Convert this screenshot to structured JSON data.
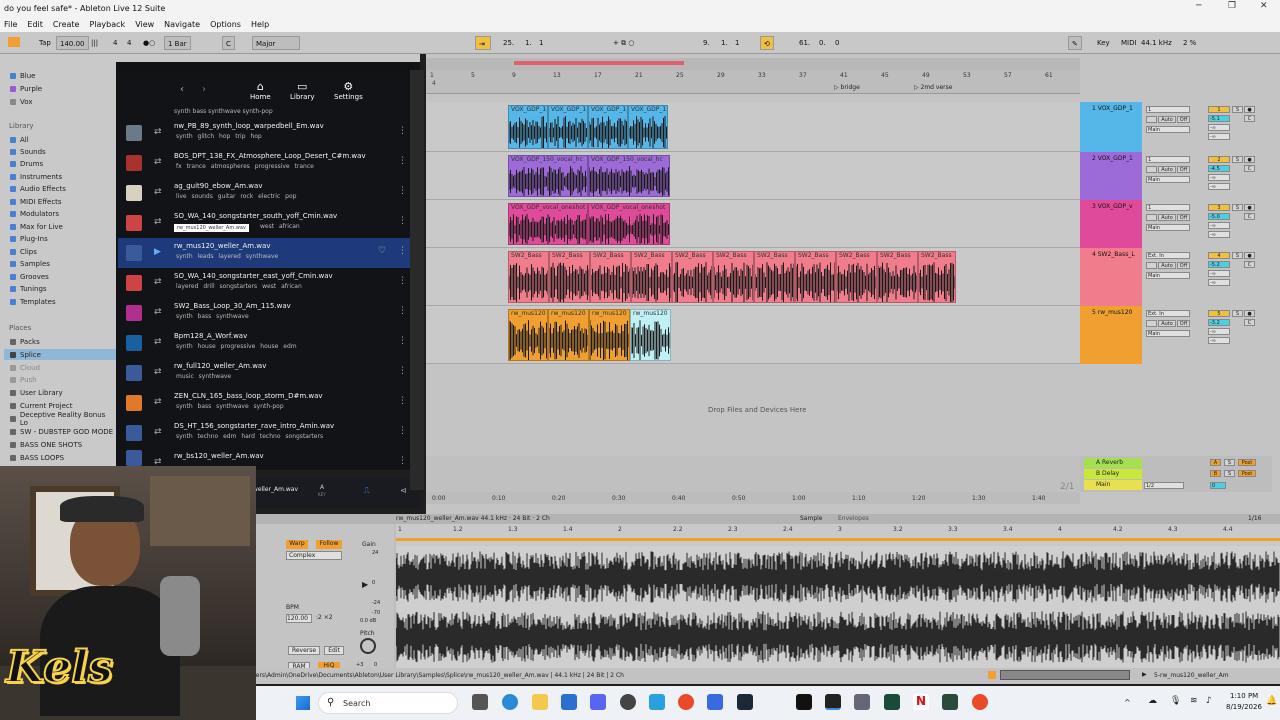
{
  "window": {
    "title": "do you feel safe* - Ableton Live 12 Suite"
  },
  "menu": [
    "File",
    "Edit",
    "Create",
    "Playback",
    "View",
    "Navigate",
    "Options",
    "Help"
  ],
  "control_bar": {
    "tap": "Tap",
    "tempo": "140.00",
    "time_sig_num": "4",
    "time_sig_den": "4",
    "quantize": "1 Bar",
    "key": "C",
    "scale": "Major",
    "position": [
      "25.",
      "1.",
      "1"
    ],
    "loop_start": [
      "9.",
      "1.",
      "1"
    ],
    "loop_length": [
      "61.",
      "0.",
      "0"
    ],
    "key_label": "Key",
    "midi_label": "MIDI",
    "sample_rate": "44.1 kHz",
    "cpu": "2 %"
  },
  "browser": {
    "colors": [
      {
        "label": "Blue",
        "color": "#4a7fd6"
      },
      {
        "label": "Purple",
        "color": "#9b59d6"
      },
      {
        "label": "Vox",
        "color": "#888888"
      }
    ],
    "library_heading": "Library",
    "library": [
      "All",
      "Sounds",
      "Drums",
      "Instruments",
      "Audio Effects",
      "MIDI Effects",
      "Modulators",
      "Max for Live",
      "Plug-Ins",
      "Clips",
      "Samples",
      "Grooves",
      "Tunings",
      "Templates"
    ],
    "places_heading": "Places",
    "places": [
      "Packs",
      "Splice",
      "Cloud",
      "Push",
      "User Library",
      "Current Project",
      "Deceptive Reality Bonus Lo",
      "SW - DUBSTEP GOD MODE",
      "BASS ONE SHOTS",
      "BASS LOOPS"
    ]
  },
  "splice": {
    "nav": {
      "home": "Home",
      "library": "Library",
      "settings": "Settings"
    },
    "top_tags": "synth  bass  synthwave  synth-pop",
    "rows": [
      {
        "name": "nw_PB_89_synth_loop_warpedbell_Em.wav",
        "tags": "synth  glitch hop  trip hop",
        "color": "#6a7a8a"
      },
      {
        "name": "BOS_DPT_138_FX_Atmosphere_Loop_Desert_C#m.wav",
        "tags": "fx  trance  atmospheres  progressive trance",
        "color": "#a8322e"
      },
      {
        "name": "ag_guit90_ebow_Am.wav",
        "tags": "live sounds  guitar  rock  electric  pop",
        "color": "#d9d0c0"
      },
      {
        "name": "SO_WA_140_songstarter_south_yoff_Cmin.wav",
        "tags": "west african",
        "tooltip": "rw_mus120_weller_Am.wav",
        "color": "#c44"
      },
      {
        "name": "rw_mus120_weller_Am.wav",
        "tags": "synth  leads  layered  synthwave",
        "color": "#3b5a9c",
        "active": true
      },
      {
        "name": "SO_WA_140_songstarter_east_yoff_Cmin.wav",
        "tags": "layered  drill  songstarters  west african",
        "color": "#c44"
      },
      {
        "name": "SW2_Bass_Loop_30_Am_115.wav",
        "tags": "synth  bass  synthwave",
        "color": "#b03090"
      },
      {
        "name": "Bpm128_A_Worf.wav",
        "tags": "synth  house  progressive house  edm",
        "color": "#1a5fa0"
      },
      {
        "name": "rw_full120_weller_Am.wav",
        "tags": "music  synthwave",
        "color": "#3b5a9c"
      },
      {
        "name": "ZEN_CLN_165_bass_loop_storm_D#m.wav",
        "tags": "synth  bass  synthwave  synth-pop",
        "color": "#e07a2a"
      },
      {
        "name": "DS_HT_156_songstarter_rave_intro_Amin.wav",
        "tags": "synth  techno  edm  hard techno  songstarters",
        "color": "#3b5a9c"
      },
      {
        "name": "rw_bs120_weller_Am.wav",
        "tags": "",
        "color": "#3b5a9c"
      }
    ],
    "player": {
      "name": "rw_mus120_weller_Am.wav",
      "key": "A",
      "key_sub": "KEY"
    }
  },
  "arrangement": {
    "bars": [
      "1",
      "5",
      "9",
      "13",
      "17",
      "21",
      "25",
      "29",
      "33",
      "37",
      "41",
      "45",
      "49",
      "53",
      "57",
      "61"
    ],
    "locators": [
      "bridge",
      "2md verse"
    ],
    "times": [
      "0:00",
      "0:10",
      "0:20",
      "0:30",
      "0:40",
      "0:50",
      "1:00",
      "1:10",
      "1:20",
      "1:30",
      "1:40"
    ],
    "page": "2/1",
    "drop_hint": "Drop Files and Devices Here",
    "tracks": [
      {
        "name": "1 VOX_GDP_1",
        "color": "#55b6e8",
        "clips": [
          "VOX_GDP_1",
          "VOX_GDP_1",
          "VOX_GDP_1",
          "VOX_GDP_1"
        ],
        "num": "1",
        "input": "1",
        "vol": "-5.1"
      },
      {
        "name": "2 VOX_GDP_1",
        "color": "#9d6bd8",
        "clips": [
          "VOX_GDP_150_vocal_hc",
          "VOX_GDP_150_vocal_hc"
        ],
        "num": "2",
        "input": "1",
        "vol": "-4.5"
      },
      {
        "name": "3 VOX_GDP_v",
        "color": "#e04a9a",
        "clips": [
          "VOX_GDP_vocal_oneshot",
          "VOX_GDP_vocal_oneshot"
        ],
        "num": "3",
        "input": "1",
        "vol": "-5.0"
      },
      {
        "name": "4 SW2_Bass_L",
        "color": "#f07c8c",
        "clips": [
          "SW2_Bass",
          "SW2_Bass",
          "SW2_Bass",
          "SW2_Bass",
          "SW2_Bass",
          "SW2_Bass",
          "SW2_Bass",
          "SW2_Bass",
          "SW2_Bass",
          "SW2_Bass",
          "SW2_Bass"
        ],
        "num": "4",
        "input": "Ext. In",
        "vol": "-5.2"
      },
      {
        "name": "5 rw_mus120",
        "color": "#f0a030",
        "clips": [
          "rw_mus120",
          "rw_mus120",
          "rw_mus120",
          "rw_mus120"
        ],
        "num": "5",
        "input": "Ext. In",
        "vol": "-3.2"
      }
    ],
    "returns": [
      {
        "name": "A Reverb",
        "letter": "A",
        "color": "#a6e052"
      },
      {
        "name": "B Delay",
        "letter": "B",
        "color": "#c8e83a"
      },
      {
        "name": "Main",
        "letter": "",
        "color": "#e8e050"
      }
    ],
    "mixer_labels": {
      "auto": "Auto",
      "off": "Off",
      "main": "Main",
      "s": "S",
      "c": "C",
      "inf": "-∞",
      "post": "Post",
      "half": "1/2",
      "zero": "0"
    }
  },
  "detail": {
    "header": "rw_mus120_weller_Am.wav  44.1 kHz · 24 Bit · 2 Ch",
    "tabs": [
      "Sample",
      "Envelopes"
    ],
    "zoom": "1/16",
    "warp": "Warp",
    "follow": "Follow",
    "mode": "Complex",
    "gain": "Gain",
    "gain_db": "0.0 dB",
    "bpm_label": "BPM",
    "bpm": "120.00",
    "reverse": "Reverse",
    "edit": "Edit",
    "ram": "RAM",
    "hiq": "HiQ",
    "pitch": "Pitch",
    "pitch_val": "+3",
    "pitch_fine": "0",
    "ruler": [
      "1",
      "1.2",
      "1.3",
      "1.4",
      "2",
      "2.2",
      "2.3",
      "2.4",
      "3",
      "3.2",
      "3.3",
      "3.4",
      "4",
      "4.2",
      "4.3",
      "4.4"
    ],
    "gain_ticks": [
      "24",
      "0",
      "-24",
      "-70"
    ]
  },
  "status": {
    "path": "C:\\Users\\Admin\\OneDrive\\Documents\\Ableton\\User Library\\Samples\\Splice\\rw_mus120_weller_Am.wav | 44.1 kHz | 24 Bit | 2 Ch",
    "track_name": "5-rw_mus120_weller_Am"
  },
  "taskbar": {
    "search": "Search",
    "time": "1:10 PM",
    "date": "8/19/2026"
  },
  "webcam": {
    "logo": "Kels"
  },
  "colors": {
    "accent": "#f0a030",
    "cyan": "#4ad0e0",
    "selection": "#1e3a7a"
  }
}
